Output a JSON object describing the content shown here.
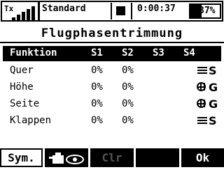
{
  "status": {
    "tx_label": "Tx",
    "signal_bars": 5,
    "model_name": "Standard",
    "timer": "0:00:37",
    "battery_text": "37%",
    "battery_level": 0.37
  },
  "title": "Flugphasentrimmung",
  "table": {
    "headers": [
      "Funktion",
      "S1",
      "S2",
      "S3",
      "S4"
    ],
    "rows": [
      {
        "funktion": "Quer",
        "s1": "0%",
        "s2": "0%",
        "s3": "",
        "mode": "S",
        "mode_icon": "lines-icon"
      },
      {
        "funktion": "Höhe",
        "s1": "0%",
        "s2": "0%",
        "s3": "",
        "mode": "G",
        "mode_icon": "globe-icon"
      },
      {
        "funktion": "Seite",
        "s1": "0%",
        "s2": "0%",
        "s3": "",
        "mode": "G",
        "mode_icon": "globe-icon"
      },
      {
        "funktion": "Klappen",
        "s1": "0%",
        "s2": "0%",
        "s3": "",
        "mode": "S",
        "mode_icon": "lines-icon"
      }
    ]
  },
  "softkeys": {
    "sym": "Sym.",
    "view_icon": "camera-eye-icon",
    "clr": "Clr",
    "ok": "Ok"
  }
}
